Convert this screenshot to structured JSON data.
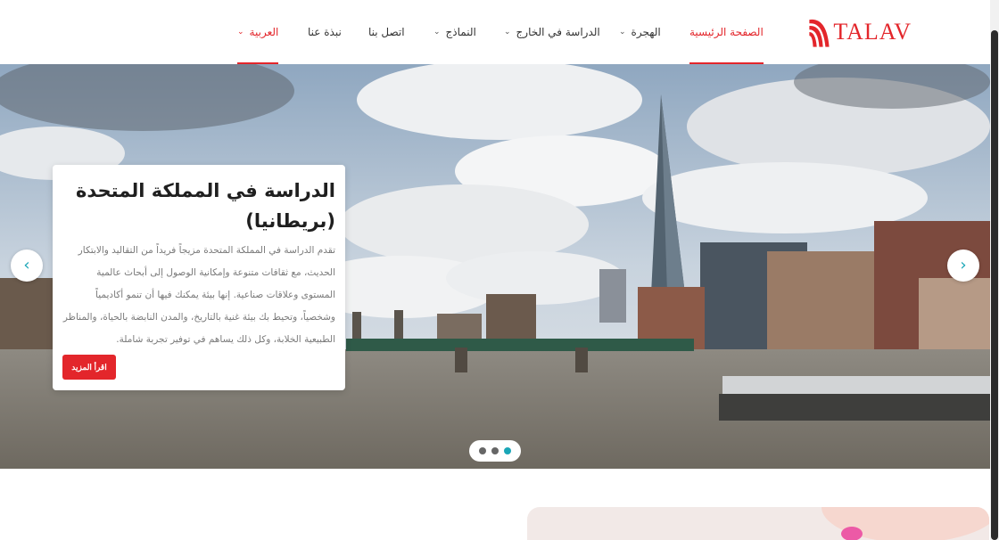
{
  "brand": {
    "logo_text": "TALAV",
    "accent_color": "#e3262b",
    "teal_color": "#1aa6b7"
  },
  "nav": {
    "items": [
      {
        "label": "الصفحة الرئيسية",
        "active": true,
        "dropdown": false
      },
      {
        "label": "الهجرة",
        "active": false,
        "dropdown": true
      },
      {
        "label": "الدراسة في الخارج",
        "active": false,
        "dropdown": true
      },
      {
        "label": "النماذج",
        "active": false,
        "dropdown": true
      },
      {
        "label": "اتصل بنا",
        "active": false,
        "dropdown": false
      },
      {
        "label": "نبذة عنا",
        "active": false,
        "dropdown": false
      },
      {
        "label": "العربية",
        "active": true,
        "dropdown": true
      }
    ]
  },
  "hero": {
    "title": "الدراسة في المملكة المتحدة (بريطانيا)",
    "text": "تقدم الدراسة في المملكة المتحدة مزيجاً فريداً من التقاليد والابتكار الحديث، مع ثقافات متنوعة وإمكانية الوصول إلى أبحاث عالمية المستوى وعلاقات صناعية. إنها بيئة يمكنك فيها أن تنمو أكاديمياً وشخصياً، وتحيط بك بيئة غنية بالتاريخ، والمدن النابضة بالحياة، والمناظر الطبيعية الخلابة، وكل ذلك يساهم في توفير تجربة شاملة.",
    "button_label": "اقرأ المزيد",
    "prev_icon": "chevron-left-icon",
    "next_icon": "chevron-right-icon",
    "prev_glyph": "‹",
    "next_glyph": "›",
    "slides_count": 3,
    "active_slide": 3
  }
}
